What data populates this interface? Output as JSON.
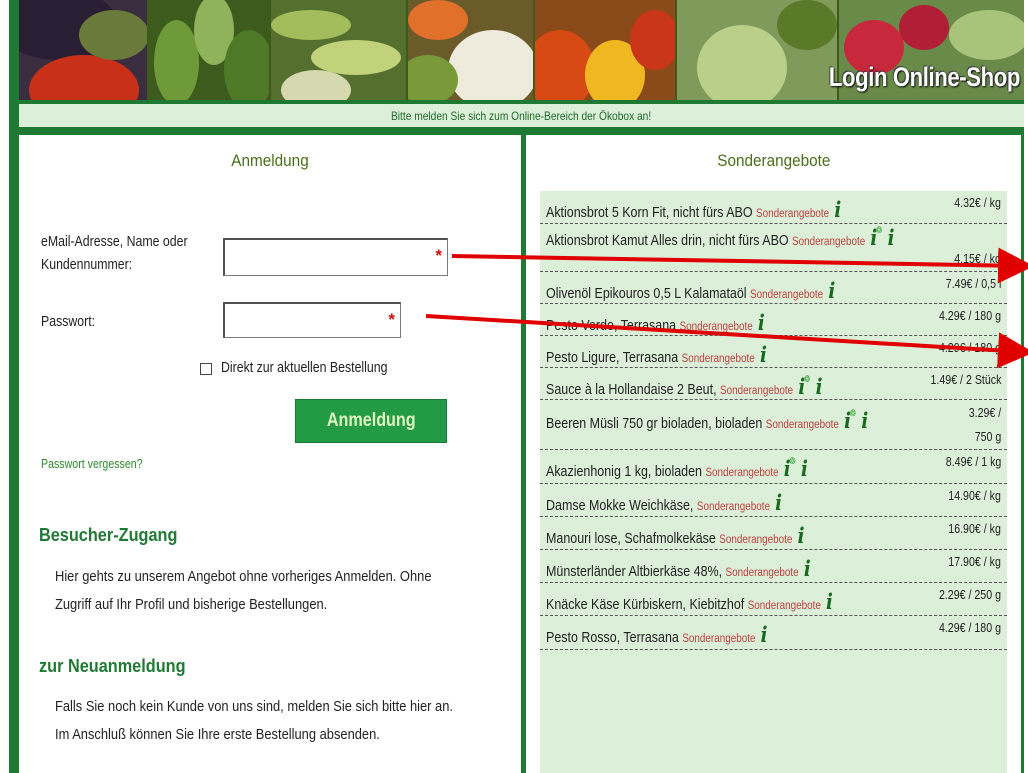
{
  "banner": {
    "title": "Login Online-Shop"
  },
  "subbar": {
    "text": "Bitte melden Sie sich zum Online-Bereich der Ökobox an!"
  },
  "login": {
    "title": "Anmeldung",
    "email_label_line1": "eMail-Adresse, Name oder",
    "email_label_line2": "Kundennummer:",
    "email_value": "",
    "password_label": "Passwort:",
    "password_value": "",
    "required_marker": "*",
    "direct_order_label": "Direkt zur aktuellen Bestellung",
    "direct_order_checked": false,
    "submit_label": "Anmeldung",
    "forgot_label": "Passwort vergessen?"
  },
  "visitor": {
    "heading": "Besucher-Zugang",
    "line1": "Hier gehts zu unserem Angebot ohne vorheriges Anmelden. Ohne",
    "line2": "Zugriff auf Ihr Profil und bisherige Bestellungen."
  },
  "register": {
    "heading": "zur Neuanmeldung",
    "line1": "Falls Sie noch kein Kunde von uns sind, melden Sie sich bitte hier an.",
    "line2": "Im Anschluß können Sie Ihre erste Bestellung absenden."
  },
  "offers": {
    "title": "Sonderangebote",
    "tag": "Sonderangebote",
    "items": [
      {
        "name": "Aktionsbrot 5 Korn Fit, nicht fürs ABO",
        "price": "4.32€ / kg",
        "eco": false
      },
      {
        "name": "Aktionsbrot Kamut Alles drin, nicht fürs ABO",
        "price": "4.15€ / kg",
        "eco": true
      },
      {
        "name": "Olivenöl Epikouros 0,5 L Kalamataöl",
        "price": "7.49€ / 0,5 l",
        "eco": false
      },
      {
        "name": "Pesto Verde, Terrasana",
        "price": "4.29€ / 180 g",
        "eco": false
      },
      {
        "name": "Pesto Ligure, Terrasana",
        "price": "4.29€ / 180 g",
        "eco": false
      },
      {
        "name": "Sauce à la Hollandaise 2 Beut,",
        "price": "1.49€ / 2 Stück",
        "eco": true
      },
      {
        "name": "Beeren Müsli 750 gr bioladen, bioladen",
        "price_line1": "3.29€ /",
        "price_line2": "750 g",
        "eco": true
      },
      {
        "name": "Akazienhonig 1 kg, bioladen",
        "price": "8.49€ / 1 kg",
        "eco": true
      },
      {
        "name": "Damse Mokke Weichkäse,",
        "price": "14.90€ / kg",
        "eco": false
      },
      {
        "name": "Manouri lose, Schafmolkekäse",
        "price": "16.90€ / kg",
        "eco": false
      },
      {
        "name": "Münsterländer Altbierkäse 48%,",
        "price": "17.90€ / kg",
        "eco": false
      },
      {
        "name": "Knäcke Käse Kürbiskern, Kiebitzhof",
        "price": "2.29€ / 250 g",
        "eco": false
      },
      {
        "name": "Pesto Rosso, Terrasana",
        "price": "4.29€ / 180 g",
        "eco": false
      }
    ]
  },
  "icons": {
    "info": "i",
    "eco_badge": "i"
  },
  "colors": {
    "frame": "#1e7a33",
    "panel_bg": "#dcefd9",
    "button": "#229a46",
    "tag": "#c24040",
    "arrow": "#e00000"
  }
}
